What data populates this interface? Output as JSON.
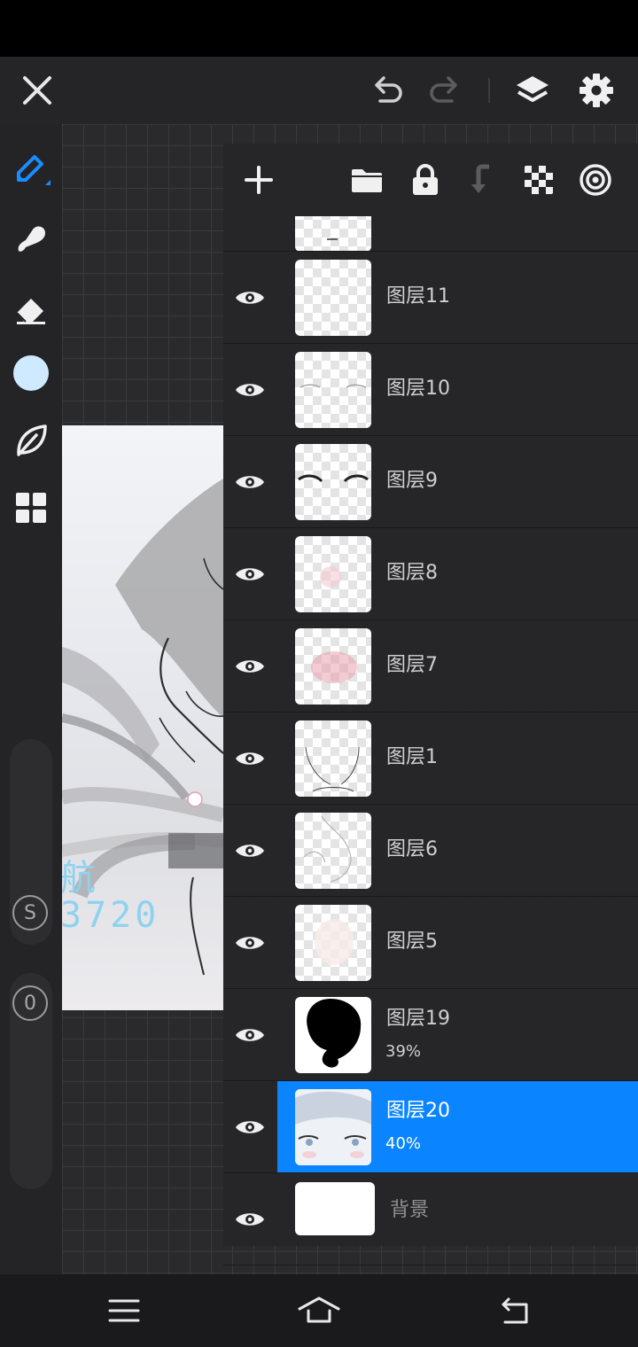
{
  "header": {
    "close_icon": "close-icon",
    "undo_icon": "undo-icon",
    "redo_icon": "redo-icon",
    "layers_icon": "layers-icon",
    "settings_icon": "gear-icon"
  },
  "toolbar": {
    "tools": [
      "pen-icon",
      "smudge-icon",
      "eraser-icon",
      "color-swatch",
      "leaf-icon",
      "grid-icon"
    ],
    "current_color": "#cfeaff",
    "size_slider_label": "S",
    "opacity_slider_label": "0"
  },
  "canvas": {
    "watermark_line1": "航",
    "watermark_line2": "3720"
  },
  "layers_toolbar": {
    "icons": [
      "add-layer-icon",
      "folder-icon",
      "lock-icon",
      "merge-down-icon",
      "checkerboard-icon",
      "target-icon"
    ]
  },
  "layers": [
    {
      "name": "图层11",
      "opacity": "",
      "visible": true,
      "selected": false
    },
    {
      "name": "图层10",
      "opacity": "",
      "visible": true,
      "selected": false
    },
    {
      "name": "图层9",
      "opacity": "",
      "visible": true,
      "selected": false
    },
    {
      "name": "图层8",
      "opacity": "",
      "visible": true,
      "selected": false
    },
    {
      "name": "图层7",
      "opacity": "",
      "visible": true,
      "selected": false
    },
    {
      "name": "图层1",
      "opacity": "",
      "visible": true,
      "selected": false
    },
    {
      "name": "图层6",
      "opacity": "",
      "visible": true,
      "selected": false
    },
    {
      "name": "图层5",
      "opacity": "",
      "visible": true,
      "selected": false
    },
    {
      "name": "图层19",
      "opacity": "39%",
      "visible": true,
      "selected": false
    },
    {
      "name": "图层20",
      "opacity": "40%",
      "visible": true,
      "selected": true
    },
    {
      "name": "背景",
      "opacity": "",
      "visible": true,
      "selected": false
    }
  ],
  "colors": {
    "accent": "#0a84ff",
    "pen_active": "#1a8cff"
  },
  "navbar": {
    "icons": [
      "menu-icon",
      "home-icon",
      "back-icon"
    ]
  }
}
